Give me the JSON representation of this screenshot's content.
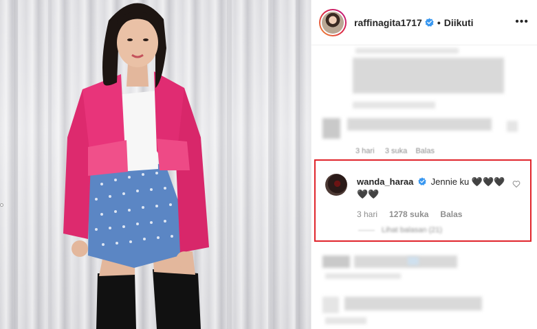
{
  "post": {
    "author_username": "raffinagita1717",
    "separator": "•",
    "follow_status": "Diikuti",
    "more_glyph": "•••"
  },
  "comments": {
    "blurred_meta": {
      "time": "3 hari",
      "likes": "3 suka",
      "reply": "Balas"
    },
    "highlighted": {
      "username": "wanda_haraa",
      "text": "Jennie ku 🖤🖤🖤🖤🖤",
      "time": "3 hari",
      "likes": "1278 suka",
      "reply": "Balas",
      "hidden_replies": "Lihat balasan (21)"
    }
  },
  "colors": {
    "highlight_border": "#e0242b",
    "verified_blue": "#3897f0",
    "meta_gray": "#8e8e8e",
    "text_dark": "#262626"
  },
  "icons": {
    "verified": "verified-badge-icon",
    "like": "heart-icon",
    "more": "more-options-icon"
  }
}
